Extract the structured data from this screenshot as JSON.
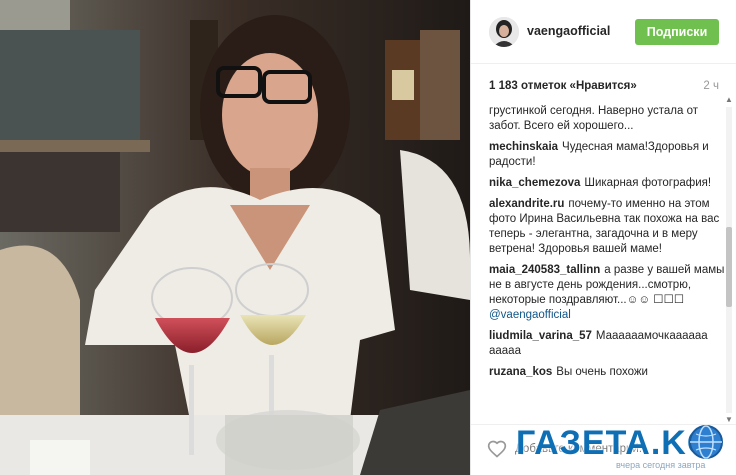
{
  "post": {
    "username": "vaengaofficial",
    "follow_label": "Подписки",
    "likes": "1 183 отметок «Нравится»",
    "time": "2 ч",
    "add_comment_placeholder": "Добавьте комментарий..."
  },
  "comments": [
    {
      "user": "",
      "text": "грустинкой сегодня. Наверно устала от забот. Всего ей хорошего..."
    },
    {
      "user": "mechinskaia",
      "text": "Чудесная мама!Здоровья и радости!"
    },
    {
      "user": "nika_chemezova",
      "text": "Шикарная фотография!"
    },
    {
      "user": "alexandrite.ru",
      "text": "почему-то именно на этом фото Ирина Васильевна так похожа на вас теперь - элегантна, загадочна и в меру ветрена! Здоровья вашей маме!"
    },
    {
      "user": "maia_240583_tallinn",
      "text": "а разве у вашей мамы не в августе день рождения...смотрю, некоторые поздравляют...☺☺ ☐☐☐",
      "mention": "@vaengaofficial"
    },
    {
      "user": "liudmila_varina_57",
      "text": "Маааааамочкаааааа ааааа"
    },
    {
      "user": "ruzana_kos",
      "text": "Вы очень похожи"
    }
  ],
  "watermark": {
    "logo": "ГАЗЕТА.KG",
    "tagline": "вчера сегодня завтра"
  },
  "colors": {
    "follow_green": "#70c050",
    "mention_blue": "#125688",
    "watermark_blue": "#0f6fb5"
  },
  "icons": [
    "heart-icon",
    "globe-icon",
    "scroll-up-arrow",
    "scroll-down-arrow"
  ]
}
